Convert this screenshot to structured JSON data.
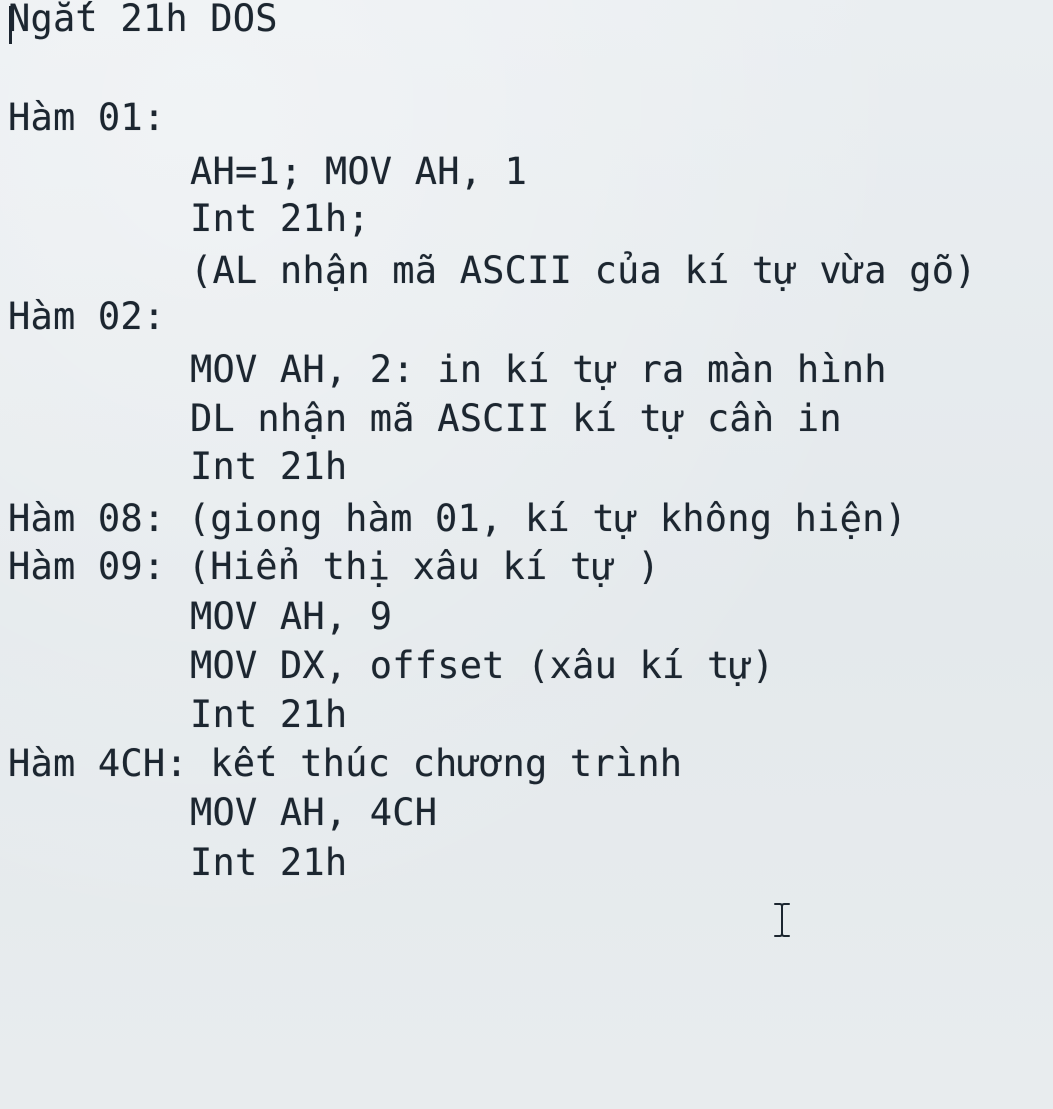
{
  "document": {
    "title": "Ngắt 21h DOS",
    "sections": [
      {
        "heading": "Hàm 01:",
        "lines": [
          "AH=1; MOV AH, 1",
          "Int 21h;",
          "(AL nhận mã ASCII của kí tự vừa gõ)"
        ]
      },
      {
        "heading": "Hàm 02:",
        "lines": [
          "MOV AH, 2: in kí tự ra màn hình",
          "DL nhận mã ASCII kí tự cần in",
          "Int 21h"
        ]
      },
      {
        "heading": "Hàm 08: (giong hàm 01, kí tự không hiện)",
        "lines": []
      },
      {
        "heading": "Hàm 09: (Hiển thị xâu kí tự )",
        "lines": [
          "MOV AH, 9",
          "MOV DX, offset (xâu kí tự)",
          "Int 21h"
        ]
      },
      {
        "heading": "Hàm 4CH: kết thúc chương trình",
        "lines": [
          "MOV AH, 4CH",
          "Int 21h"
        ]
      }
    ]
  },
  "colors": {
    "background": "#e7ebee",
    "text": "#1c2630"
  },
  "icons": {
    "text_cursor": "ibeam-cursor-icon"
  }
}
